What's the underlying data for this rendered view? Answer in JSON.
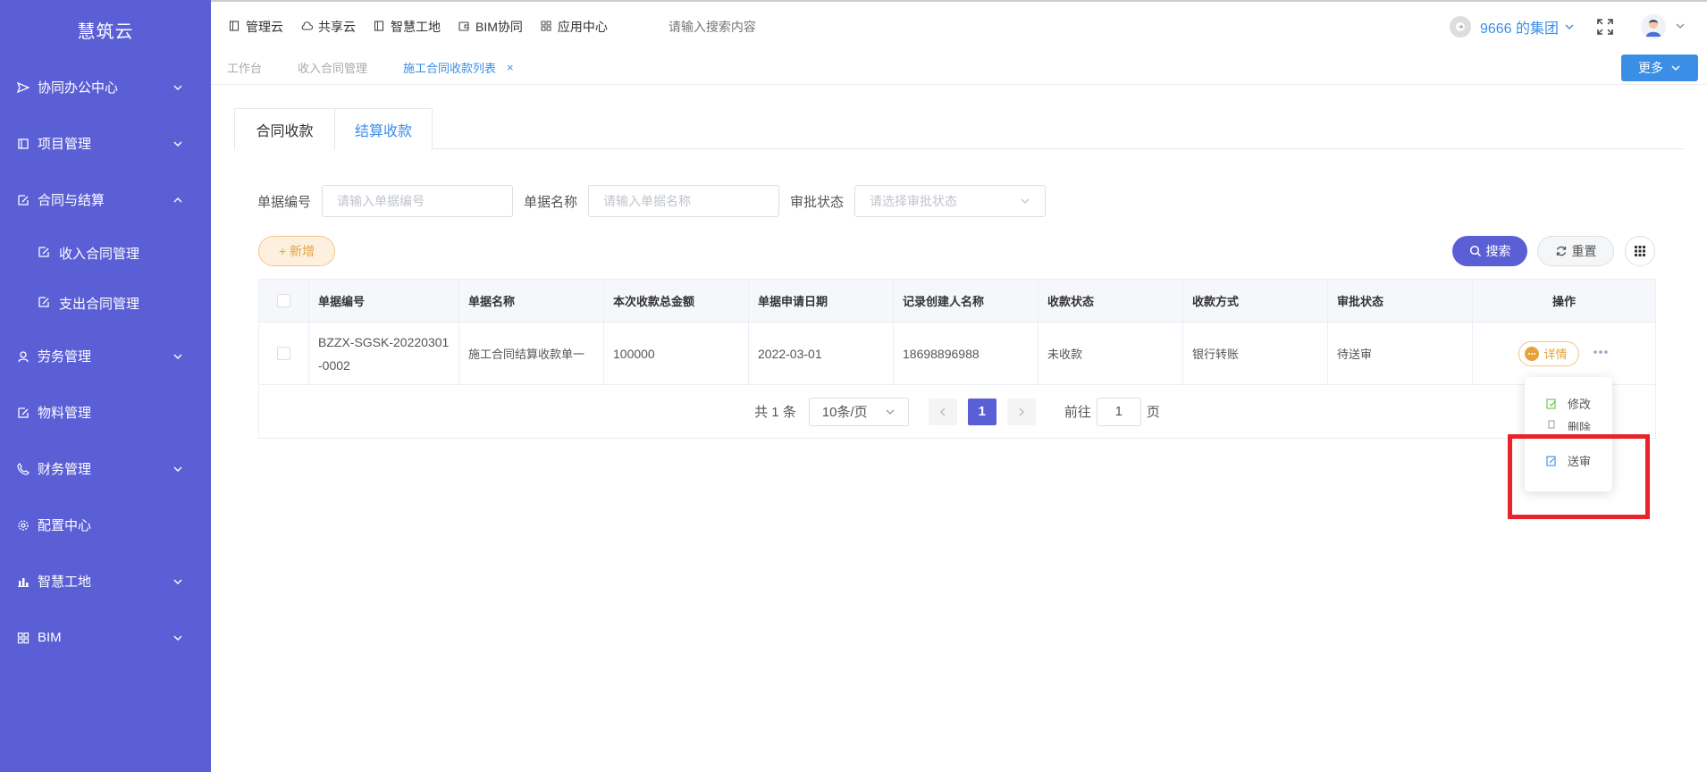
{
  "sidebar": {
    "logo": "慧筑云",
    "items": [
      {
        "label": "协同办公中心",
        "icon": "send-icon",
        "chevron": "down"
      },
      {
        "label": "项目管理",
        "icon": "book-icon",
        "chevron": "down"
      },
      {
        "label": "合同与结算",
        "icon": "edit-doc-icon",
        "chevron": "up"
      },
      {
        "label": "劳务管理",
        "icon": "user-icon",
        "chevron": "down"
      },
      {
        "label": "物料管理",
        "icon": "edit-doc-icon",
        "chevron": "none"
      },
      {
        "label": "财务管理",
        "icon": "phone-icon",
        "chevron": "down"
      },
      {
        "label": "配置中心",
        "icon": "gear-icon",
        "chevron": "none"
      },
      {
        "label": "智慧工地",
        "icon": "bar-chart-icon",
        "chevron": "down"
      },
      {
        "label": "BIM",
        "icon": "grid-icon",
        "chevron": "down"
      }
    ],
    "subitems": [
      {
        "label": "收入合同管理",
        "icon": "edit-doc-icon"
      },
      {
        "label": "支出合同管理",
        "icon": "edit-doc-icon"
      }
    ]
  },
  "topbar": {
    "nav": [
      {
        "label": "管理云",
        "icon": "square-icon"
      },
      {
        "label": "共享云",
        "icon": "cloud-icon"
      },
      {
        "label": "智慧工地",
        "icon": "square-icon"
      },
      {
        "label": "BIM协同",
        "icon": "wallet-icon"
      },
      {
        "label": "应用中心",
        "icon": "grid-icon"
      }
    ],
    "search_placeholder": "请输入搜索内容",
    "group": "9666 的集团"
  },
  "tabs": {
    "items": [
      "工作台",
      "收入合同管理",
      "施工合同收款列表"
    ],
    "active_index": 2,
    "more": "更多"
  },
  "content": {
    "subtabs": [
      "合同收款",
      "结算收款"
    ],
    "active_subtab": 1,
    "filters": {
      "code_label": "单据编号",
      "code_placeholder": "请输入单据编号",
      "name_label": "单据名称",
      "name_placeholder": "请输入单据名称",
      "status_label": "审批状态",
      "status_placeholder": "请选择审批状态"
    },
    "buttons": {
      "add": "+ 新增",
      "search": "搜索",
      "reset": "重置"
    },
    "table": {
      "headers": [
        "单据编号",
        "单据名称",
        "本次收款总金额",
        "单据申请日期",
        "记录创建人名称",
        "收款状态",
        "收款方式",
        "审批状态",
        "操作"
      ],
      "rows": [
        [
          "BZZX-SGSK-20220301-0002",
          "施工合同结算收款单一",
          "100000",
          "2022-03-01",
          "18698896988",
          "未收款",
          "银行转账",
          "待送审"
        ]
      ],
      "detail_label": "详情"
    },
    "pagination": {
      "total": "共 1 条",
      "page_size": "10条/页",
      "current": "1",
      "goto_label": "前往",
      "goto_value": "1",
      "page_suffix": "页"
    },
    "dropdown": {
      "items": [
        "修改",
        "删除",
        "送审"
      ]
    }
  },
  "colors": {
    "sidebar": "#5b5fd6",
    "accent": "#3a8ee6",
    "warning": "#e6a23c",
    "highlight": "#e8232b"
  }
}
